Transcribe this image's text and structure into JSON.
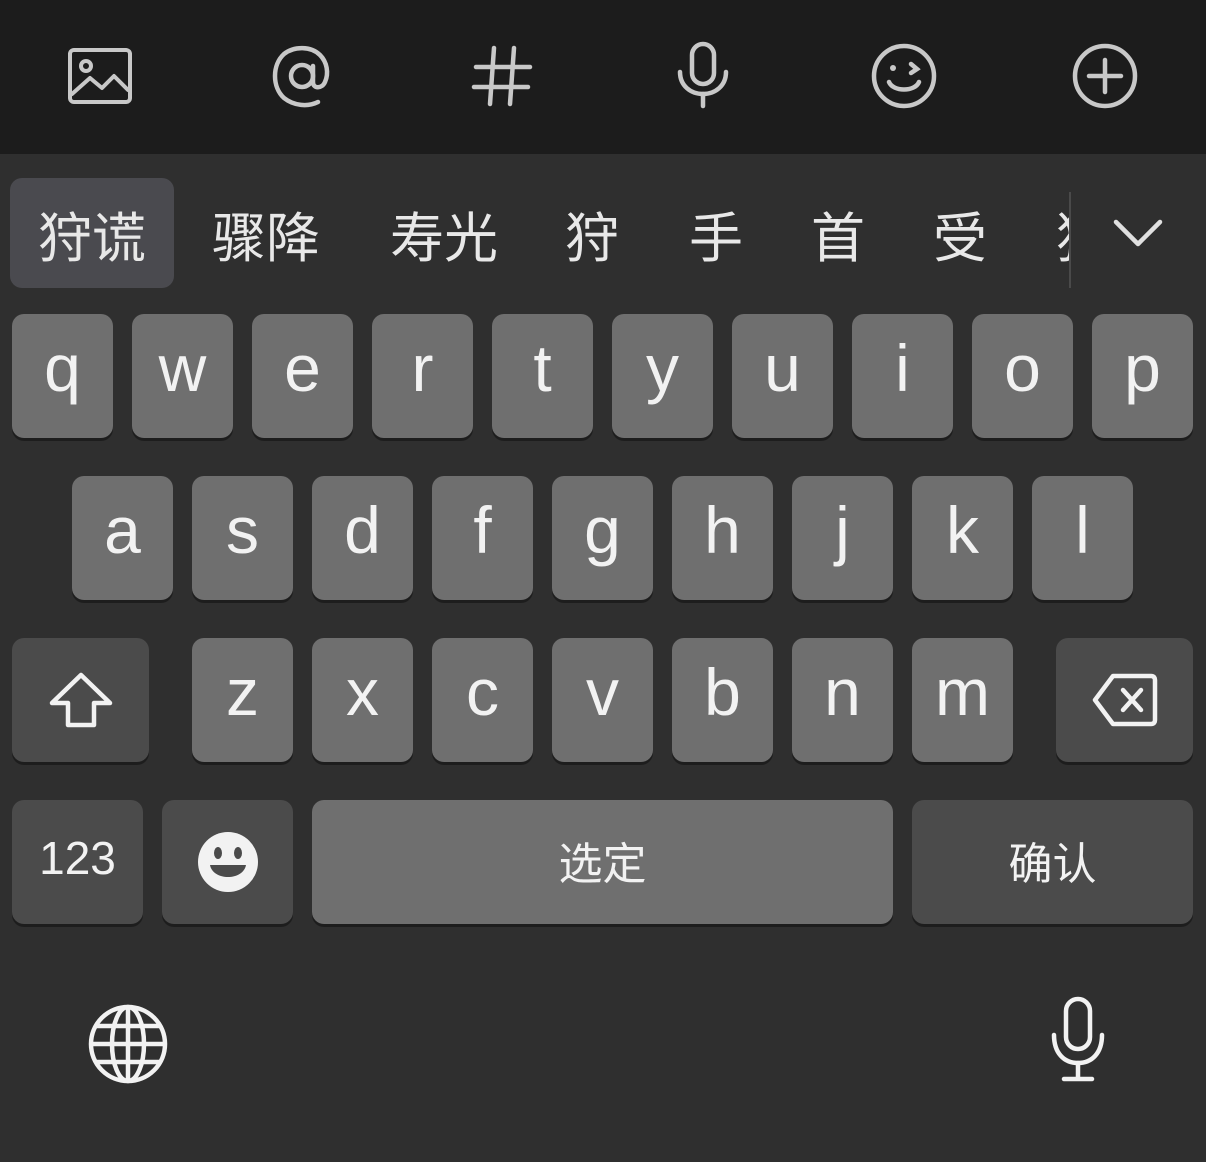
{
  "toolbar": {
    "icons": [
      "image-icon",
      "at-icon",
      "hashtag-icon",
      "microphone-icon",
      "emoji-icon",
      "add-icon"
    ]
  },
  "candidates": {
    "items": [
      "狩谎",
      "骤降",
      "寿光",
      "狩",
      "手",
      "首",
      "受",
      "狩"
    ],
    "selected_index": 0,
    "expand_icon": "chevron-down-icon"
  },
  "keys": {
    "row1": [
      "q",
      "w",
      "e",
      "r",
      "t",
      "y",
      "u",
      "i",
      "o",
      "p"
    ],
    "row2": [
      "a",
      "s",
      "d",
      "f",
      "g",
      "h",
      "j",
      "k",
      "l"
    ],
    "row3": [
      "z",
      "x",
      "c",
      "v",
      "b",
      "n",
      "m"
    ],
    "shift_icon": "shift-icon",
    "backspace_icon": "backspace-icon",
    "numbers_label": "123",
    "emoji_icon": "emoji-key-icon",
    "space_label": "选定",
    "return_label": "确认"
  },
  "bottom": {
    "globe_icon": "globe-icon",
    "dictation_icon": "microphone-icon"
  },
  "colors": {
    "toolbar_bg": "#1c1c1c",
    "keyboard_bg": "#2f2f2f",
    "key_light": "#6f6f6f",
    "key_dark": "#4b4b4b",
    "selected_candidate_bg": "#4a4a4f"
  }
}
